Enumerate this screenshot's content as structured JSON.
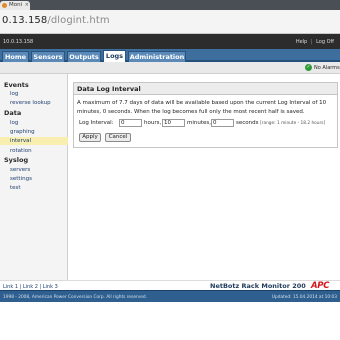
{
  "browser": {
    "tab_title": "Moni",
    "tab_close": "×",
    "url_host": "0.13.158",
    "url_path": "/dlogint.htm"
  },
  "top_strip": {
    "ip": "10.0.13.158",
    "links": [
      "Help",
      "Log Off"
    ],
    "separator": "|"
  },
  "nav": {
    "tabs": [
      "Home",
      "Sensors",
      "Outputs",
      "Logs",
      "Administration"
    ],
    "active": "Logs"
  },
  "status": {
    "alarm_text": "No Alarms",
    "alarm_icon": "check-circle-icon",
    "alarm_color": "#2e9a36"
  },
  "sidebar": {
    "sections": [
      {
        "title": "Events",
        "items": [
          "log",
          "reverse lookup"
        ]
      },
      {
        "title": "Data",
        "items": [
          "log",
          "graphing",
          "interval",
          "rotation"
        ]
      },
      {
        "title": "Syslog",
        "items": [
          "servers",
          "settings",
          "test"
        ]
      }
    ],
    "active_item": "interval"
  },
  "panel": {
    "title": "Data Log Interval",
    "description": "A maximum of 7.7 days of data will be available based upon the current Log Interval of 10 minutes, 0 seconds. When the log becomes full only the most recent half is saved.",
    "field_label": "Log Interval:",
    "hours_value": "0",
    "hours_unit": "hours,",
    "minutes_value": "10",
    "minutes_unit": "minutes,",
    "seconds_value": "0",
    "seconds_unit": "seconds",
    "range_hint": "[range: 1 minute - 18.2 hours]",
    "apply_label": "Apply",
    "cancel_label": "Cancel"
  },
  "footer": {
    "links": "Link 1 | Link 2 | Link 3",
    "product_name": "NetBotz Rack Monitor 200",
    "logo_text": "APC",
    "copyright": "1998 - 2008, American Power Conversion Corp. All rights reserved.",
    "updated": "Updated: 15.04.2014 at 10:03"
  },
  "colors": {
    "nav_bar": "#3d6e9e",
    "footer_bar": "#2f5f8e",
    "active_sidebar": "#f7eeb0",
    "logo_red": "#d4161c"
  }
}
